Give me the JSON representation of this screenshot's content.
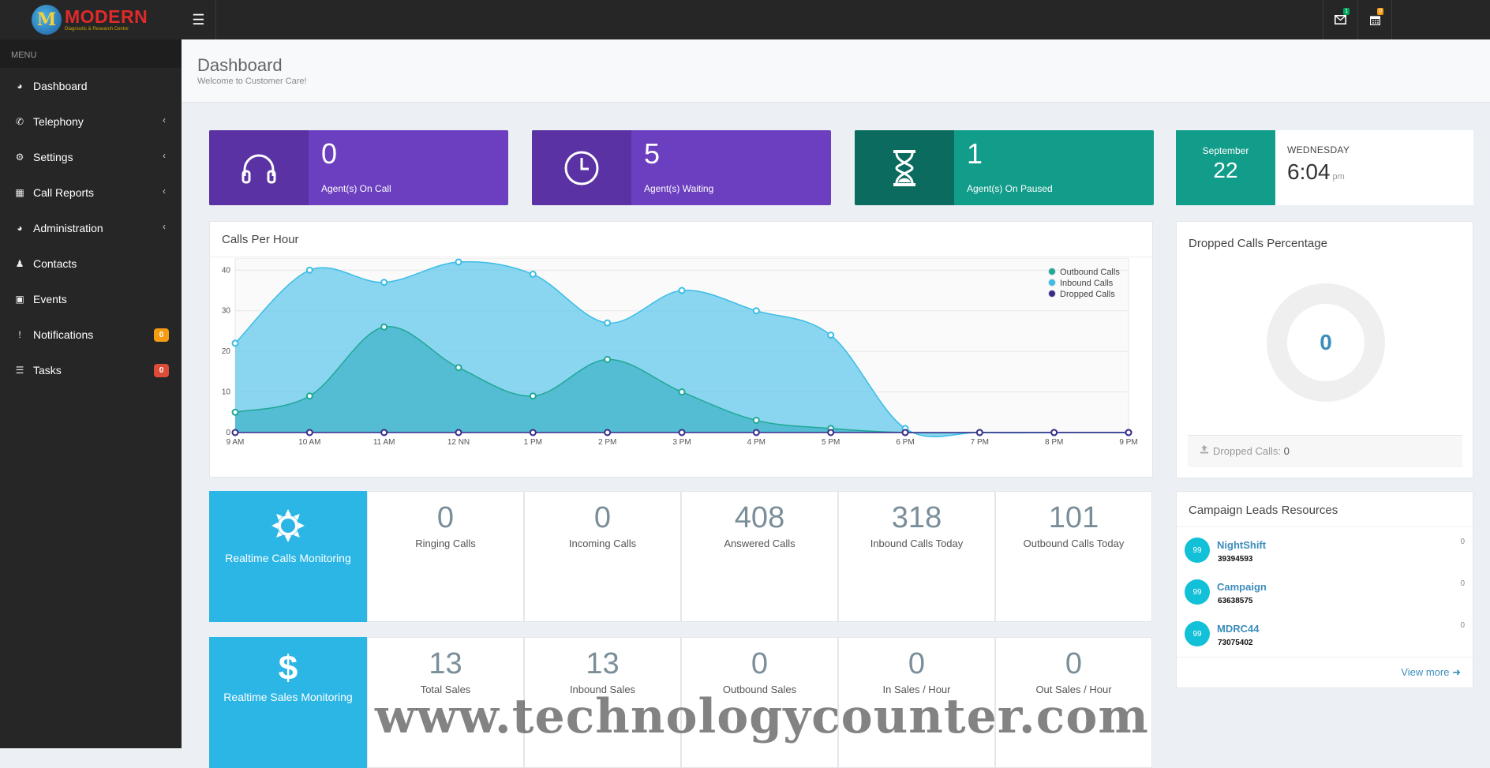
{
  "app": {
    "logo_letter": "M",
    "brand": "MODERN",
    "brand_sub": "Diagnostic & Research Centre"
  },
  "topbar": {
    "menu_icon": "bars-icon",
    "mail_badge": "1",
    "calendar_badge": "0",
    "mail_badge_color": "#00a65a",
    "calendar_badge_color": "#f39c12"
  },
  "sidebar": {
    "heading": "MENU",
    "items": [
      {
        "label": "Dashboard",
        "icon": "dashboard-icon",
        "has_submenu": false
      },
      {
        "label": "Telephony",
        "icon": "phone-icon",
        "has_submenu": true
      },
      {
        "label": "Settings",
        "icon": "gear-icon",
        "has_submenu": true
      },
      {
        "label": "Call Reports",
        "icon": "bar-chart-icon",
        "has_submenu": true
      },
      {
        "label": "Administration",
        "icon": "dashboard-icon",
        "has_submenu": true
      },
      {
        "label": "Contacts",
        "icon": "users-icon",
        "has_submenu": false
      },
      {
        "label": "Events",
        "icon": "calendar-icon",
        "has_submenu": false
      },
      {
        "label": "Notifications",
        "icon": "exclamation-icon",
        "badge": "0",
        "badge_color": "#f39c12"
      },
      {
        "label": "Tasks",
        "icon": "tasks-icon",
        "badge": "0",
        "badge_color": "#dd4b39"
      }
    ]
  },
  "header": {
    "title": "Dashboard",
    "subtitle": "Welcome to Customer Care!"
  },
  "info_boxes": [
    {
      "value": "0",
      "label": "Agent(s) On Call",
      "icon": "headphones-icon",
      "color": "#6b3fbf",
      "icon_bg": "#5a32a3"
    },
    {
      "value": "5",
      "label": "Agent(s) Waiting",
      "icon": "clock-icon",
      "color": "#6b3fbf",
      "icon_bg": "#5a32a3"
    },
    {
      "value": "1",
      "label": "Agent(s) On Paused",
      "icon": "hourglass-icon",
      "color": "#129c8a",
      "icon_bg": "#0b6b5e"
    }
  ],
  "datebox": {
    "month": "September",
    "day": "22",
    "weekday": "WEDNESDAY",
    "time": "6:04",
    "ampm": "pm"
  },
  "calls_chart": {
    "title": "Calls Per Hour"
  },
  "chart_data": {
    "type": "area",
    "title": "Calls Per Hour",
    "categories": [
      "9 AM",
      "10 AM",
      "11 AM",
      "12 NN",
      "1 PM",
      "2 PM",
      "3 PM",
      "4 PM",
      "5 PM",
      "6 PM",
      "7 PM",
      "8 PM",
      "9 PM"
    ],
    "ylim": [
      0,
      42
    ],
    "yticks": [
      0,
      10,
      20,
      30,
      40
    ],
    "grid": true,
    "legend_position": "top-right",
    "series": [
      {
        "name": "Outbound Calls",
        "color": "#1fa896",
        "values": [
          5,
          9,
          26,
          16,
          9,
          18,
          10,
          3,
          1,
          0,
          0,
          0,
          0
        ]
      },
      {
        "name": "Inbound Calls",
        "color": "#3bbde6",
        "values": [
          22,
          40,
          37,
          42,
          39,
          27,
          35,
          30,
          24,
          1,
          0,
          0,
          0
        ]
      },
      {
        "name": "Dropped Calls",
        "color": "#3b2a8a",
        "values": [
          0,
          0,
          0,
          0,
          0,
          0,
          0,
          0,
          0,
          0,
          0,
          0,
          0
        ]
      }
    ]
  },
  "dropped": {
    "title": "Dropped Calls Percentage",
    "value": "0",
    "footer_label": "Dropped Calls:",
    "footer_value": "0"
  },
  "calls_monitor": {
    "title": "Realtime Calls Monitoring",
    "icon": "sun-icon",
    "stats": [
      {
        "value": "0",
        "label": "Ringing Calls"
      },
      {
        "value": "0",
        "label": "Incoming Calls"
      },
      {
        "value": "408",
        "label": "Answered Calls"
      },
      {
        "value": "318",
        "label": "Inbound Calls Today"
      },
      {
        "value": "101",
        "label": "Outbound Calls Today"
      }
    ]
  },
  "sales_monitor": {
    "title": "Realtime Sales Monitoring",
    "icon": "dollar-icon",
    "stats": [
      {
        "value": "13",
        "label": "Total Sales"
      },
      {
        "value": "13",
        "label": "Inbound Sales"
      },
      {
        "value": "0",
        "label": "Outbound Sales"
      },
      {
        "value": "0",
        "label": "In Sales / Hour"
      },
      {
        "value": "0",
        "label": "Out Sales / Hour"
      }
    ]
  },
  "campaign": {
    "title": "Campaign Leads Resources",
    "items": [
      {
        "avatar": "99",
        "name": "NightShift",
        "id": "39394593",
        "count": "0"
      },
      {
        "avatar": "99",
        "name": "Campaign",
        "id": "63638575",
        "count": "0"
      },
      {
        "avatar": "99",
        "name": "MDRC44",
        "id": "73075402",
        "count": "0"
      }
    ],
    "view_more": "View more"
  },
  "watermark": "www.technologycounter.com"
}
